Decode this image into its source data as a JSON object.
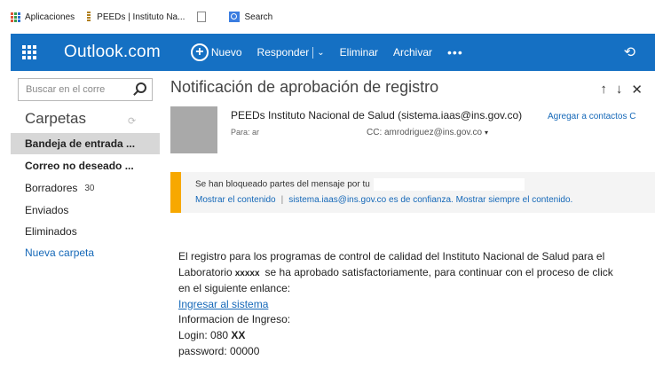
{
  "bookmarks": {
    "items": [
      {
        "label": "Aplicaciones",
        "icon": "apps-grid-icon"
      },
      {
        "label": "PEEDs | Instituto Na...",
        "icon": "peeds-icon"
      },
      {
        "label": "",
        "icon": "page-icon"
      },
      {
        "label": "Search",
        "icon": "search-icon"
      }
    ]
  },
  "topbar": {
    "brand": "Outlook.com",
    "color": "#1570c3",
    "new_label": "Nuevo",
    "reply_label": "Responder",
    "delete_label": "Eliminar",
    "archive_label": "Archivar",
    "more_label": "•••",
    "undo_icon": "undo-icon"
  },
  "sidebar": {
    "search_placeholder": "Buscar en el corre",
    "folders_title": "Carpetas",
    "items": [
      {
        "label": "Bandeja de entrada ...",
        "selected": true
      },
      {
        "label": "Correo no deseado ...",
        "bold": true
      },
      {
        "label": "Borradores",
        "count": "30"
      },
      {
        "label": "Enviados"
      },
      {
        "label": "Eliminados"
      },
      {
        "label": "Nueva carpeta",
        "link": true
      }
    ]
  },
  "message": {
    "subject": "Notificación de aprobación de registro",
    "sender": "PEEDs Instituto Nacional de Salud  (sistema.iaas@ins.gov.co)",
    "add_contacts": "Agregar a contactos C",
    "to": "Para: ar",
    "cc": "CC: amrodriguez@ins.gov.co",
    "blocked_notice": "Se han bloqueado partes del mensaje por tu",
    "show_content": "Mostrar el contenido",
    "separator": "|",
    "trust_notice": "sistema.iaas@ins.gov.co es de confianza. Mostrar siempre el contenido.",
    "body": {
      "line1": "El registro para los programas de control de calidad del Instituto Nacional de Salud para el",
      "line2_pre": "Laboratorio",
      "line2_redact": "xxxxx",
      "line2_post": "se ha aprobado satisfactoriamente, para continuar con el proceso de click",
      "line3": "en el siguiente enlance:",
      "link": "Ingresar al sistema",
      "line5": "Informacion de Ingreso:",
      "login_pre": "Login: 080",
      "login_x": "XX",
      "password": "password: 00000"
    }
  }
}
